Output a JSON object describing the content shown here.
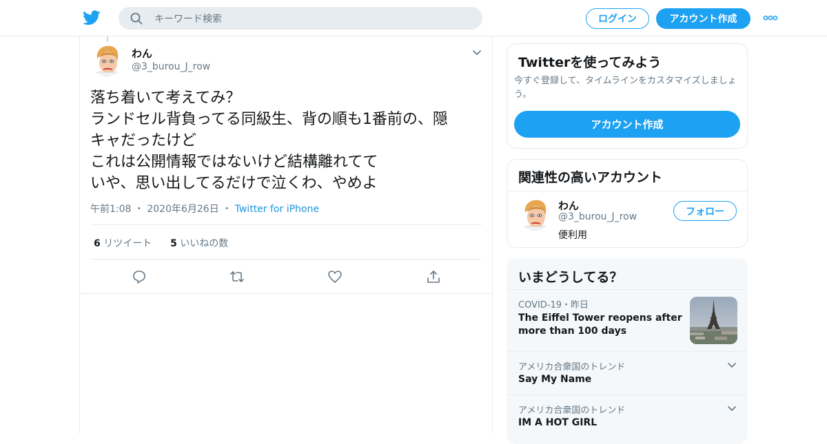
{
  "header": {
    "search_placeholder": "キーワード検索",
    "login_label": "ログイン",
    "signup_label": "アカウント作成",
    "icons": {
      "logo": "twitter-bird-icon",
      "search": "search-icon",
      "more": "more-dots-icon"
    }
  },
  "tweet": {
    "author": {
      "name": "わん",
      "handle": "@3_burou_J_row"
    },
    "text_lines": [
      "落ち着いて考えてみ？",
      "ランドセル背負ってる同級生、背の順も1番前の、隠",
      "キャだったけど",
      "これは公開情報ではないけど結構離れてて",
      "いや、思い出してるだけで泣くわ、やめよ"
    ],
    "time": "午前1:08",
    "date": "2020年6月26日",
    "source": "Twitter for iPhone",
    "retweet_count": "6",
    "retweet_label": "リツイート",
    "like_count": "5",
    "like_label": "いいねの数"
  },
  "sidebar": {
    "signup_card": {
      "title": "Twitterを使ってみよう",
      "description": "今すぐ登録して、タイムラインをカスタマイズしましょう。",
      "button_label": "アカウント作成"
    },
    "related_card": {
      "title": "関連性の高いアカウント",
      "account": {
        "name": "わん",
        "handle": "@3_burou_J_row",
        "bio": "便利用"
      },
      "follow_label": "フォロー"
    },
    "trends_card": {
      "title": "いまどうしてる？",
      "items": [
        {
          "meta": "COVID-19・昨日",
          "title": "The Eiffel Tower reopens after more than 100 days"
        },
        {
          "meta": "アメリカ合衆国のトレンド",
          "title": "Say My Name"
        },
        {
          "meta": "アメリカ合衆国のトレンド",
          "title": "IM A HOT GIRL"
        }
      ]
    }
  },
  "colors": {
    "accent": "#1da1f2",
    "link": "#1b95e0",
    "muted_text": "#657786",
    "border": "#e6ecf0",
    "panel_bg": "#f5f8fa"
  }
}
